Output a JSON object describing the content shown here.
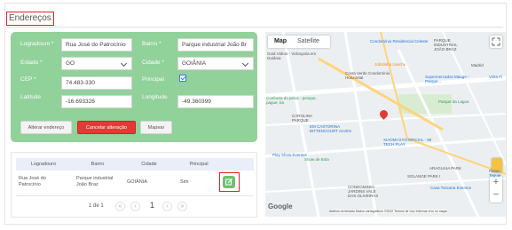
{
  "page": {
    "title": "Endereços"
  },
  "form": {
    "logradouro": {
      "label": "Logradouro *",
      "value": "Rua José do Patrocínio"
    },
    "bairro": {
      "label": "Bairro *",
      "value": "Parque industrial João Br"
    },
    "estado": {
      "label": "Estado *",
      "value": "GO"
    },
    "cidade": {
      "label": "Cidade *",
      "value": "GOIÂNIA"
    },
    "cep": {
      "label": "CEP *",
      "value": "74.483-330"
    },
    "principal": {
      "label": "Principal",
      "checked": true
    },
    "latitude": {
      "label": "Latitude",
      "value": "-16.693326"
    },
    "longitude": {
      "label": "Longitude",
      "value": "-49.360399"
    }
  },
  "actions": {
    "alterar": "Alterar endereço",
    "cancelar": "Cancelar alteração",
    "mapear": "Mapear"
  },
  "table": {
    "columns": [
      "Logradouro",
      "Bairro",
      "Cidade",
      "Principal"
    ],
    "rows": [
      {
        "logradouro": "Rua José do Patrocínio",
        "bairro": "Parque industrial João Braz",
        "cidade": "GOIÂNIA",
        "principal": "Sim"
      }
    ]
  },
  "pagination": {
    "summary": "1 de 1",
    "current": "1"
  },
  "map": {
    "tabs": [
      "Map",
      "Satellite"
    ],
    "active_tab": "Map",
    "labels": [
      "Condomínio Residencial Celeste",
      "PARQUE INDUSTRIAL JOÃO BRAZ",
      "Goiá Vidros - Vidraçaria em Goiânia",
      "Jobstinho Lanche",
      "Madrid",
      "Costa Verde Condomínio Horizontal",
      "Supermercados Mauge - Parque...",
      "Volta Fi",
      "Parque da Lagoa",
      "Confraria do peixe - pesque, pague, ba",
      "CAROLINA PARQUE",
      "EM CASTORINA BITTENCOURT ALVES",
      "XIAOMI GYN OFICIAL - MI TECH PLAY",
      "Play Show Eventos",
      "Show de Bola",
      "ARAGUAIA PARK",
      "SOLANGE PARK I",
      "Casa Toscana Eventos",
      "CONDOMINIO JARDINS VALE DAS OLIVEIRAS",
      "Parqu Taquar"
    ],
    "attribution": "Atalhos do teclado   Dados cartográficos ©2022   Termos de Uso   Informar erro no mapa",
    "logo": "Google",
    "icons": [
      "fullscreen-icon",
      "pegman-icon",
      "zoom-in-icon",
      "zoom-out-icon",
      "location-pin-icon"
    ]
  },
  "colors": {
    "form_bg": "#91d19a",
    "cancel": "#e53935",
    "highlight": "#e0242b",
    "edit": "#6cc36e",
    "pin": "#e03c31"
  }
}
